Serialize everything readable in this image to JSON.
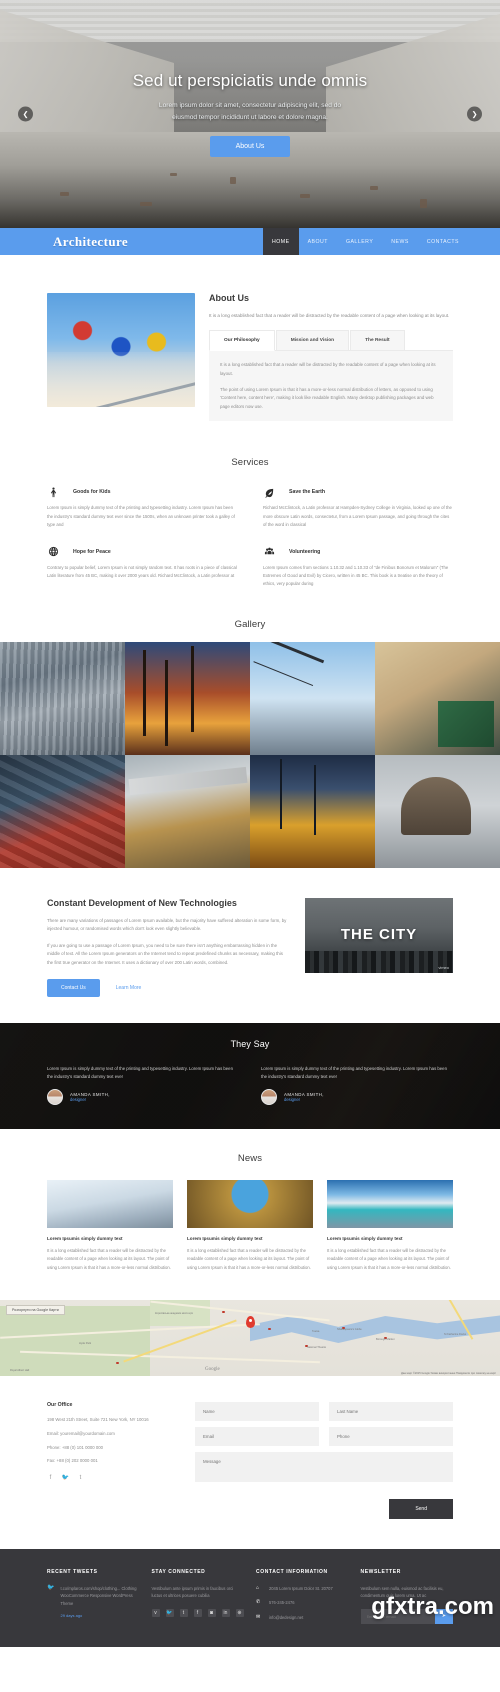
{
  "hero": {
    "title": "Sed ut perspiciatis unde omnis",
    "subtitle": "Lorem ipsum dolor sit amet, consectetur adipiscing elit, sed do eiusmod tempor incididunt ut labore et dolore magna.",
    "cta": "About Us",
    "prev_icon": "chevron-left-icon",
    "next_icon": "chevron-right-icon",
    "accent": "#5a9ced"
  },
  "nav": {
    "logo": "Architecture",
    "items": [
      {
        "label": "HOME",
        "active": true
      },
      {
        "label": "ABOUT",
        "active": false
      },
      {
        "label": "GALLERY",
        "active": false
      },
      {
        "label": "NEWS",
        "active": false
      },
      {
        "label": "CONTACTS",
        "active": false
      }
    ]
  },
  "about": {
    "title": "About Us",
    "lead": "It is a long established fact that a reader will be distracted by the readable content of a page when looking at its layout.",
    "tabs": [
      {
        "label": "Our Philosophy",
        "active": true
      },
      {
        "label": "Mission and Vision",
        "active": false
      },
      {
        "label": "The Result",
        "active": false
      }
    ],
    "panel": [
      "It is a long established fact that a reader will be distracted by the readable content of a page when looking at its layout.",
      "The point of using Lorem Ipsum is that it has a more-or-less normal distribution of letters, as opposed to using 'Content here, content here', making it look like readable English. Many desktop publishing packages and web page editors now use."
    ]
  },
  "services": {
    "title": "Services",
    "items": [
      {
        "icon": "child-icon",
        "title": "Goods for Kids",
        "text": "Lorem Ipsum is simply dummy text of the printing and typesetting industry. Lorem Ipsum has been the industry's standard dummy text ever since the 1500s, when an unknown printer took a galley of type and"
      },
      {
        "icon": "leaf-icon",
        "title": "Save the Earth",
        "text": "Richard McClintock, a Latin professor at Hampden-Sydney College in Virginia, looked up one of the more obscure Latin words, consectetur, from a Lorem Ipsum passage, and going through the cites of the word in classical"
      },
      {
        "icon": "globe-icon",
        "title": "Hope for Peace",
        "text": "Contrary to popular belief, Lorem Ipsum is not simply random text. It has roots in a piece of classical Latin literature from 45 BC, making it over 2000 years old. Richard McClintock, a Latin professor at"
      },
      {
        "icon": "people-icon",
        "title": "Volunteering",
        "text": "Lorem Ipsum comes from sections 1.10.32 and 1.10.33 of \"de Finibus Bonorum et Malorum\" (The Extremes of Good and Evil) by Cicero, written in 45 BC. This book is a treatise on the theory of ethics, very popular during"
      }
    ]
  },
  "gallery": {
    "title": "Gallery",
    "tiles": [
      "gallery-tile-skyscraper",
      "gallery-tile-sunset-crane",
      "gallery-tile-tower-crane",
      "gallery-tile-electrician",
      "gallery-tile-solar-roof",
      "gallery-tile-workers",
      "gallery-tile-night-site",
      "gallery-tile-oil-rig"
    ]
  },
  "tech": {
    "title": "Constant Development of New Technologies",
    "paragraphs": [
      "There are many variations of passages of Lorem Ipsum available, but the majority have suffered alteration in some form, by injected humour, or randomised words which don't look even slightly believable.",
      "If you are going to use a passage of Lorem Ipsum, you need to be sure there isn't anything embarrassing hidden in the middle of text. All the Lorem Ipsum generators on the Internet tend to repeat predefined chunks as necessary, making this the first true generator on the Internet. It uses a dictionary of over 200 Latin words, combined."
    ],
    "primary_btn": "Contact Us",
    "secondary_link": "Learn More",
    "video_title": "THE CITY",
    "video_brand": "vimeo"
  },
  "testimonials": {
    "title": "They Say",
    "items": [
      {
        "quote": "Lorem Ipsum is simply dummy text of the printing and typesetting industry. Lorem Ipsum has been the industry's standard dummy text ever",
        "name": "AMANDA SMITH,",
        "role": "designer"
      },
      {
        "quote": "Lorem Ipsum is simply dummy text of the printing and typesetting industry. Lorem Ipsum has been the industry's standard dummy text ever",
        "name": "AMANDA SMITH,",
        "role": "designer"
      }
    ]
  },
  "news": {
    "title": "News",
    "items": [
      {
        "image": "news-image-snow",
        "title": "Lorem Ipsumis simply dummy text",
        "text": "It is a long established fact that a reader will be distracted by the readable content of a page when looking at its layout. The point of using Lorem Ipsum is that it has a more-or-less normal distribution."
      },
      {
        "image": "news-image-galleria",
        "title": "Lorem Ipsumis simply dummy text",
        "text": "It is a long established fact that a reader will be distracted by the readable content of a page when looking at its layout. The point of using Lorem Ipsum is that it has a more-or-less normal distribution."
      },
      {
        "image": "news-image-resort",
        "title": "Lorem Ipsumis simply dummy text",
        "text": "It is a long established fact that a reader will be distracted by the readable content of a page when looking at its layout. The point of using Lorem Ipsum is that it has a more-or-less normal distribution."
      }
    ]
  },
  "map": {
    "expand_btn": "Розгорнути на Google Карти",
    "watermark": "Google",
    "attribution": "Дані карт ©2015 Google  Умови використання  Повідомити про помилку на карті",
    "labels": {
      "river": "Темза",
      "theatre": "National Theatre",
      "globe": "Shakespeare's Globe",
      "market": "Borough Market",
      "docks": "St Katharine Docks",
      "academy": "Королівська академія мистецтв",
      "hall": "Royal Albert Hall",
      "garden": "Hyde Park"
    }
  },
  "contact": {
    "office_title": "Our Office",
    "address": "198 West 21th Street, Suite 721 New York, NY 10016",
    "email": "Email: youremail@yourdomain.com",
    "phone": "Phone: +88 (0) 101 0000 000",
    "fax": "Fax: +88 (0) 202 0000 001",
    "social": [
      "facebook-icon",
      "twitter-icon",
      "tumblr-icon"
    ],
    "form": {
      "name": "Name",
      "last_name": "Last Name",
      "email": "Email",
      "phone": "Phone",
      "message": "Message",
      "send": "Send"
    }
  },
  "footer": {
    "columns": [
      {
        "heading": "RECENT TWEETS",
        "icon": "twitter-icon",
        "text": "t.co/mplaros.com/shop/clothing... Clothing WooCommerce Responsive WordPress Theme",
        "meta": "29 days ago"
      },
      {
        "heading": "STAY CONNECTED",
        "text": "Vestibulum ante ipsum primis in faucibus orci luctus et ultrices posuere cubilia",
        "social": [
          "vimeo-icon",
          "twitter-icon",
          "tumblr-icon",
          "facebook-icon",
          "instagram-icon",
          "linkedin-icon",
          "google-plus-icon"
        ]
      },
      {
        "heading": "CONTACT INFORMATION",
        "items": [
          {
            "icon": "home-icon",
            "text": "2045 Lorem Ipsum Dolor St. 20707"
          },
          {
            "icon": "phone-icon",
            "text": "576-245-2476"
          },
          {
            "icon": "mail-icon",
            "text": "info@dedesign.net"
          }
        ]
      },
      {
        "heading": "NEWSLETTER",
        "text": "Vestibulum sem nulla, euismod ac facilisis eu, condimentum quis lorem urna. Ut ac",
        "placeholder": "Enter your email",
        "button_icon": "send-icon"
      }
    ]
  },
  "watermark": "gfxtra.com"
}
